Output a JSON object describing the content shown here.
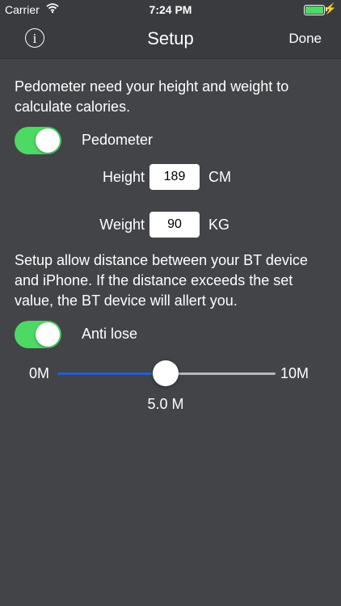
{
  "status_bar": {
    "carrier": "Carrier",
    "time": "7:24 PM",
    "icons": [
      "wifi-icon",
      "battery-icon",
      "charging-icon"
    ]
  },
  "nav": {
    "title": "Setup",
    "info_glyph": "i",
    "done_label": "Done"
  },
  "pedometer": {
    "description": "Pedometer need your height and weight to calculate calories.",
    "toggle_label": "Pedometer",
    "toggle_on": true,
    "height_label": "Height",
    "height_value": "189",
    "height_unit": "CM",
    "weight_label": "Weight",
    "weight_value": "90",
    "weight_unit": "KG"
  },
  "anti_lose": {
    "description": "Setup allow distance between your BT device and iPhone. If the distance exceeds the set value, the BT device will allert you.",
    "toggle_label": "Anti lose",
    "toggle_on": true,
    "slider_min": "0M",
    "slider_max": "10M",
    "slider_value": "5.0 M",
    "slider_fraction": 0.5
  },
  "colors": {
    "background": "#434448",
    "bar": "#3a3b3f",
    "toggle_on": "#4cd964",
    "slider_fill": "#1f5ed8",
    "slider_track": "#b8b8bc"
  }
}
